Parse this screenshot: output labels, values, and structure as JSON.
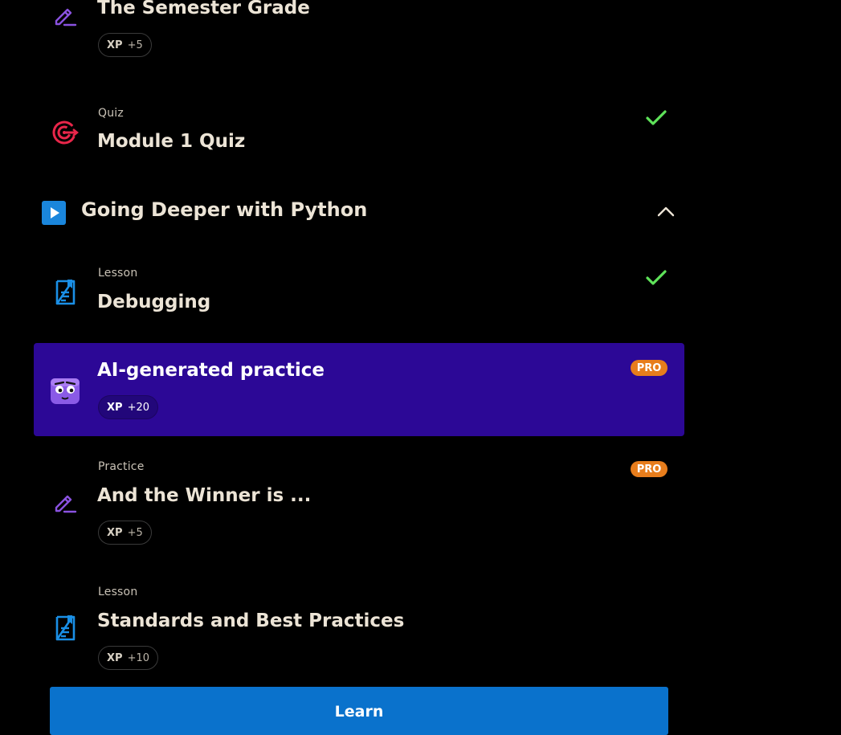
{
  "items": [
    {
      "type": "",
      "title": "The Semester Grade",
      "xp_label": "XP",
      "xp_value": "+5"
    },
    {
      "type": "Quiz",
      "title": "Module 1 Quiz",
      "completed": true
    },
    {
      "type": "Lesson",
      "title": "Debugging",
      "completed": true
    },
    {
      "type": "",
      "title": "AI-generated practice",
      "xp_label": "XP",
      "xp_value": "+20",
      "badge": "PRO",
      "highlight_color": "#2c0896"
    },
    {
      "type": "Practice",
      "title": "And the Winner is ...",
      "xp_label": "XP",
      "xp_value": "+5",
      "badge": "PRO"
    },
    {
      "type": "Lesson",
      "title": "Standards and Best Practices",
      "xp_label": "XP",
      "xp_value": "+10"
    }
  ],
  "section": {
    "title": "Going Deeper with Python",
    "expanded": true
  },
  "learn_button": {
    "label": "Learn"
  },
  "colors": {
    "accent": "#0a72cc",
    "check": "#5fe35a",
    "pro": "#e77d1c",
    "practice_icon": "#8a52e0",
    "quiz_icon": "#e8264a",
    "lesson_icon": "#1a8fe6"
  }
}
